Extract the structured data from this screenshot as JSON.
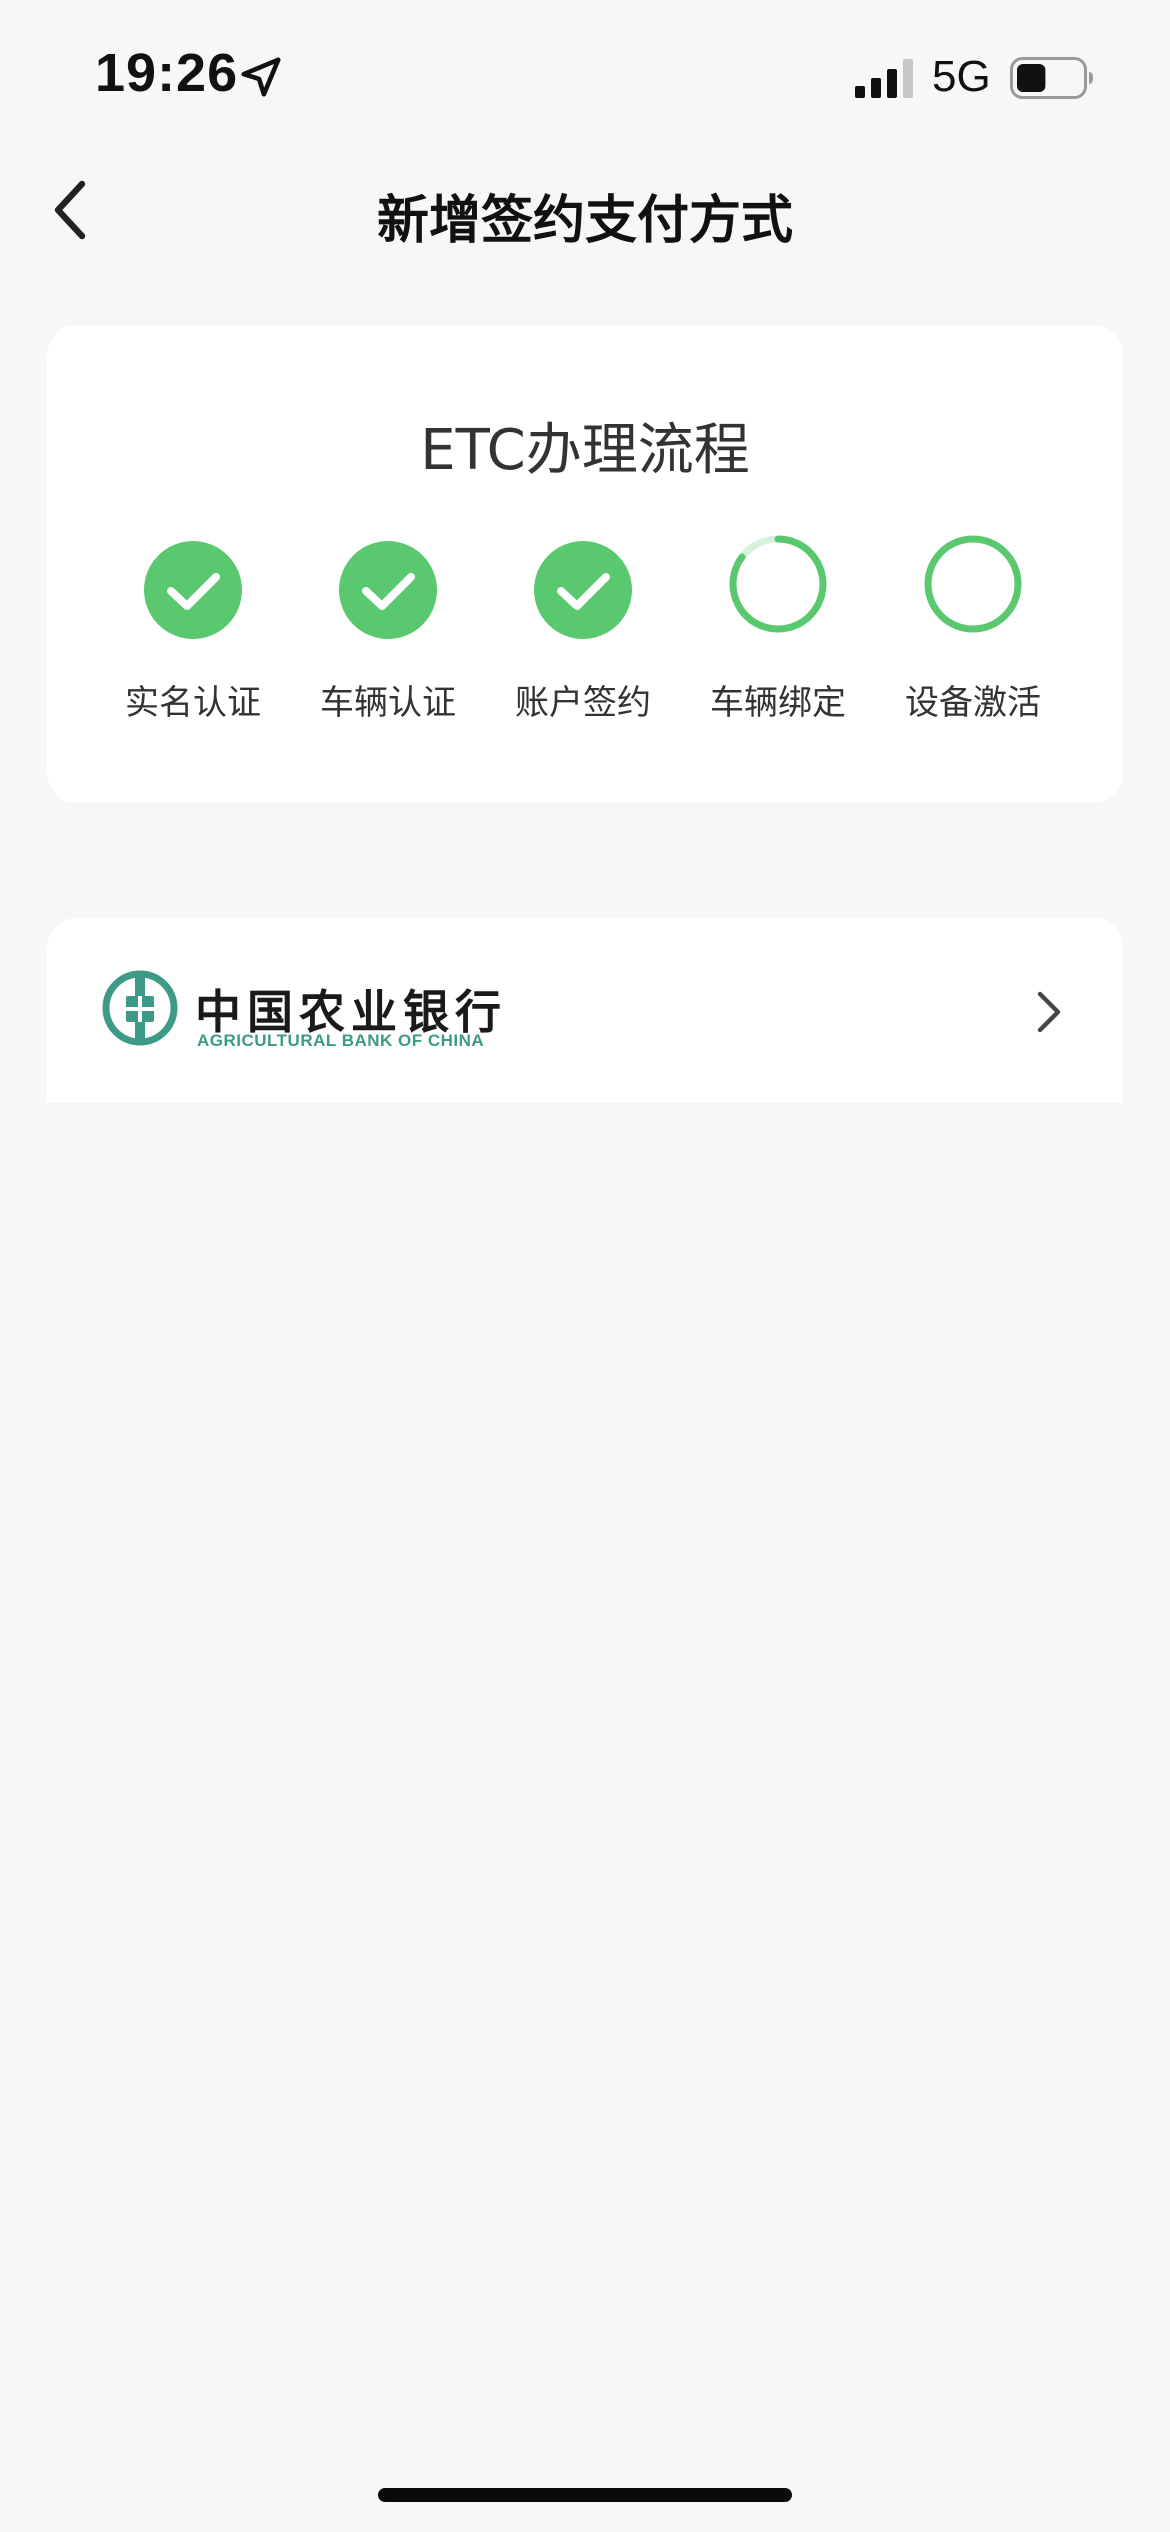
{
  "status_bar": {
    "time": "19:26",
    "network": "5G",
    "battery_level": 0.45,
    "signal_bars": 3
  },
  "nav": {
    "title": "新增签约支付方式",
    "back_icon": "chevron-left-icon"
  },
  "process": {
    "title": "ETC办理流程",
    "accent_color": "#5ac86e",
    "steps": [
      {
        "label": "实名认证",
        "status": "completed",
        "icon": "check-circle-icon"
      },
      {
        "label": "车辆认证",
        "status": "completed",
        "icon": "check-circle-icon"
      },
      {
        "label": "账户签约",
        "status": "completed",
        "icon": "check-circle-icon"
      },
      {
        "label": "车辆绑定",
        "status": "in-progress",
        "icon": "progress-ring-icon"
      },
      {
        "label": "设备激活",
        "status": "pending",
        "icon": "ring-icon"
      }
    ]
  },
  "bank": {
    "name_cn": "中国农业银行",
    "name_en": "AGRICULTURAL BANK OF CHINA",
    "brand_color": "#3d9a86",
    "chevron_icon": "chevron-right-icon"
  }
}
